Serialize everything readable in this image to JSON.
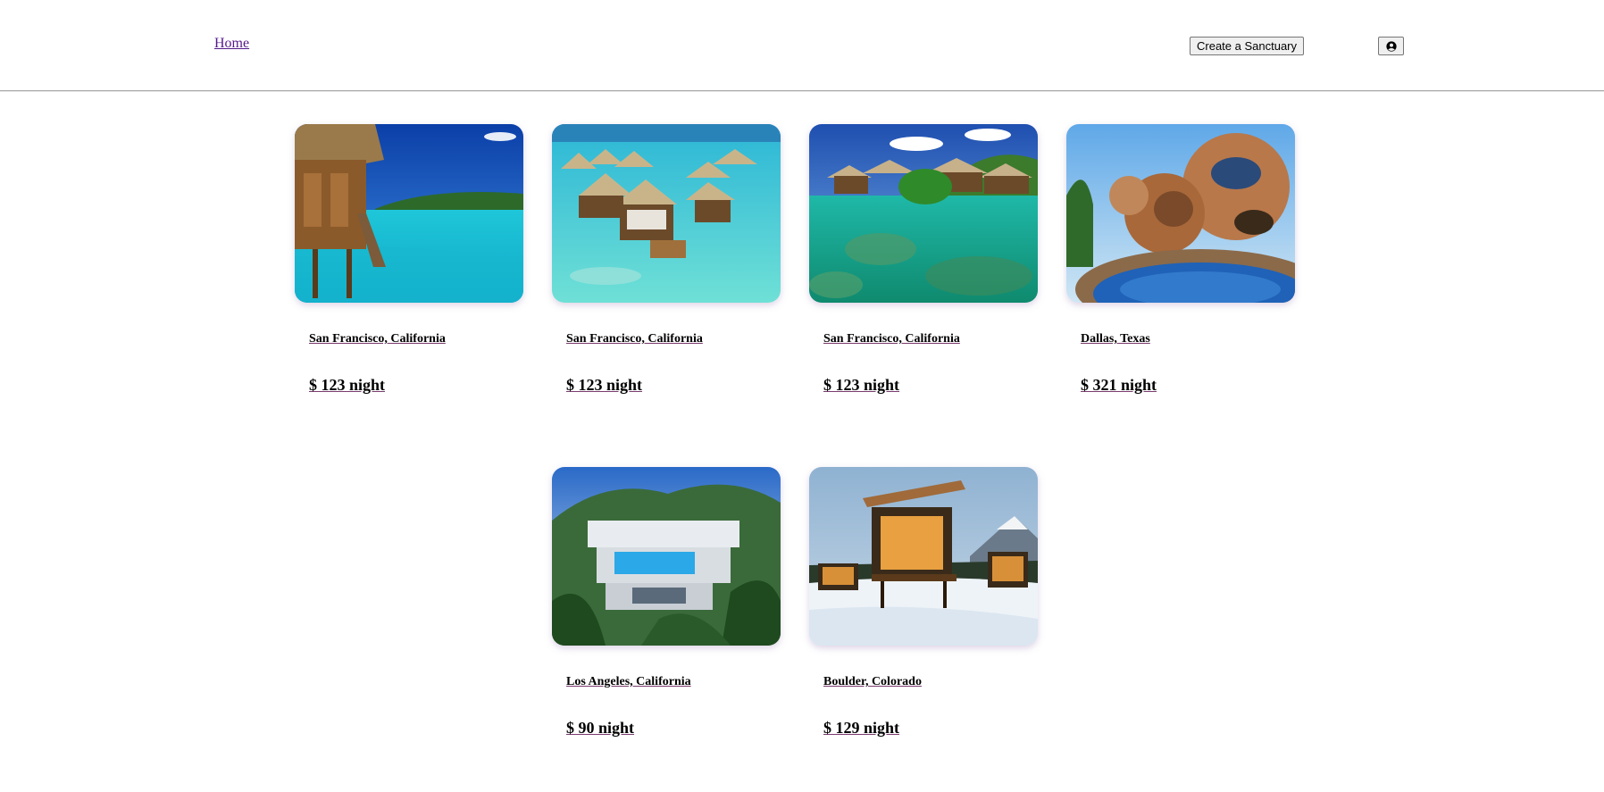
{
  "header": {
    "home_label": "Home",
    "create_label": "Create a Sanctuary",
    "user_icon": "user-circle-icon"
  },
  "listings": [
    {
      "location": "San Francisco, California",
      "price": "$ 123 night",
      "image": "overwater-bungalow-photo"
    },
    {
      "location": "San Francisco, California",
      "price": "$ 123 night",
      "image": "overwater-resort-aerial-photo"
    },
    {
      "location": "San Francisco, California",
      "price": "$ 123 night",
      "image": "lagoon-villas-photo"
    },
    {
      "location": "Dallas, Texas",
      "price": "$ 321 night",
      "image": "bubble-house-pool-photo"
    },
    {
      "location": "Los Angeles, California",
      "price": "$ 90 night",
      "image": "hillside-modern-villa-photo"
    },
    {
      "location": "Boulder, Colorado",
      "price": "$ 129 night",
      "image": "snow-cabins-photo"
    }
  ]
}
